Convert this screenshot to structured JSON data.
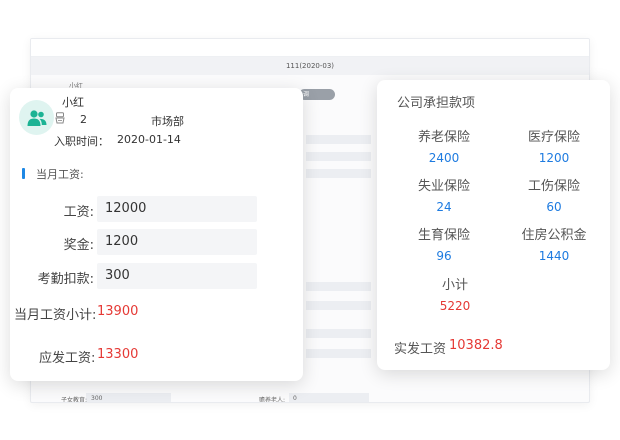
{
  "background": {
    "header_text": "111(2020-03)",
    "name": "小红",
    "pill_label": "调",
    "row1_label": "子女教育:",
    "row1_value": "300",
    "row2_label": "赡养老人:",
    "row2_value": "0"
  },
  "employee": {
    "name": "小红",
    "number": "2",
    "department": "市场部",
    "join_label": "入职时间：",
    "join_date": "2020-01-14"
  },
  "salary": {
    "section_title": "当月工资:",
    "rows": [
      {
        "label": "工资:",
        "value": "12000"
      },
      {
        "label": "奖金:",
        "value": "1200"
      },
      {
        "label": "考勤扣款:",
        "value": "300"
      }
    ],
    "subtotal_label": "当月工资小计:",
    "subtotal_value": "13900",
    "payable_label": "应发工资:",
    "payable_value": "13300"
  },
  "company": {
    "title": "公司承担款项",
    "items": [
      {
        "label": "养老保险",
        "value": "2400"
      },
      {
        "label": "医疗保险",
        "value": "1200"
      },
      {
        "label": "失业保险",
        "value": "24"
      },
      {
        "label": "工伤保险",
        "value": "60"
      },
      {
        "label": "生育保险",
        "value": "96"
      },
      {
        "label": "住房公积金",
        "value": "1440"
      }
    ],
    "subtotal_label": "小计",
    "subtotal_value": "5220",
    "actual_label": "实发工资",
    "actual_value": "10382.8"
  },
  "colors": {
    "accent_blue": "#1e7be0",
    "accent_red": "#e53935",
    "avatar_bg": "#dff4f0",
    "avatar_icon": "#1cb394"
  },
  "icons": [
    "user-group-icon",
    "id-card-icon"
  ]
}
